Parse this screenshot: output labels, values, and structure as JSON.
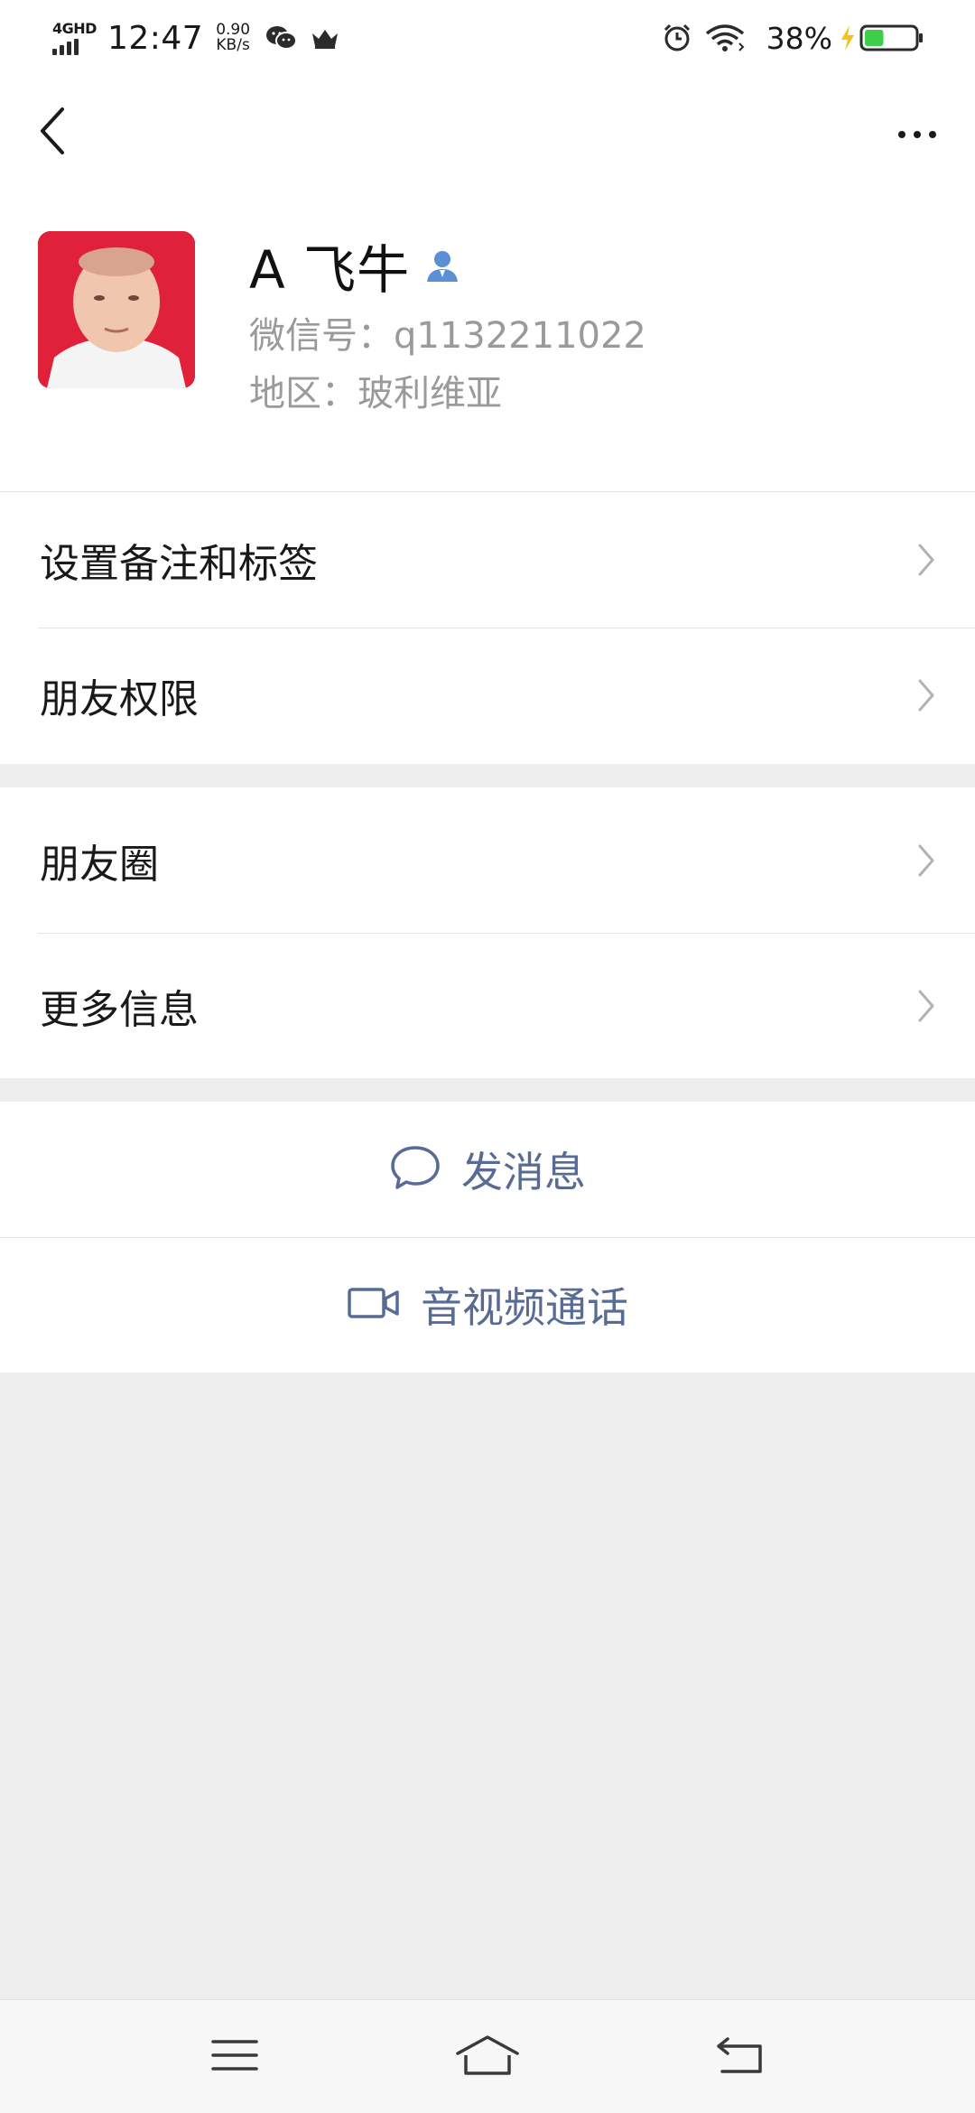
{
  "status_bar": {
    "network": "4GHD",
    "time": "12:47",
    "speed_value": "0.90",
    "speed_unit": "KB/s",
    "battery_percent": "38%",
    "icons": [
      "wechat-icon",
      "crown-icon",
      "alarm-icon",
      "wifi-icon",
      "charging-icon",
      "battery-icon"
    ],
    "battery_level": 0.38,
    "battery_color": "#3ecf4a",
    "charging_color": "#f5c21b"
  },
  "nav": {
    "back_icon": "chevron-left-icon",
    "more_icon": "more-horizontal-icon"
  },
  "profile": {
    "name": "A 飞牛",
    "wechat_id": "微信号：q1132211022",
    "region": "地区：玻利维亚",
    "avatar_bg": "#e0213a",
    "contact_icon_color": "#5b8fd6"
  },
  "menu": {
    "group1": [
      {
        "label": "设置备注和标签"
      },
      {
        "label": "朋友权限"
      }
    ],
    "group2": [
      {
        "label": "朋友圈"
      },
      {
        "label": "更多信息"
      }
    ]
  },
  "actions": {
    "send_message": "发消息",
    "video_call": "音视频通话",
    "color": "#576b95"
  },
  "system_nav": {
    "icons": [
      "menu-icon",
      "home-icon",
      "back-icon"
    ]
  }
}
